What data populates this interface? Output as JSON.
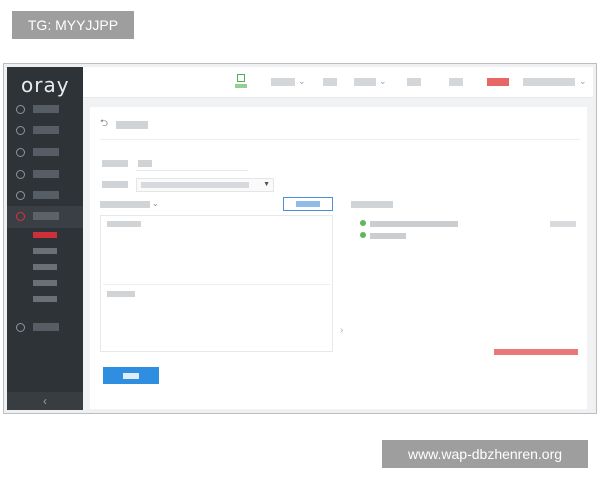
{
  "overlay_top_left": "TG: MYYJJPP",
  "overlay_bottom_right": "www.wap-dbzhenren.org",
  "app": {
    "logo": "oray",
    "collapse_glyph": "‹"
  },
  "sidebar": {
    "items": [
      {
        "icon": "grid-icon",
        "label": ""
      },
      {
        "icon": "user-icon",
        "label": ""
      },
      {
        "icon": "headset-icon",
        "label": ""
      },
      {
        "icon": "cube-icon",
        "label": ""
      },
      {
        "icon": "gear-icon",
        "label": ""
      },
      {
        "icon": "cloud-icon",
        "label": ""
      },
      {
        "icon": "router-icon",
        "label": ""
      }
    ],
    "sub_items": [
      {
        "label": ""
      },
      {
        "label": ""
      },
      {
        "label": ""
      },
      {
        "label": ""
      },
      {
        "label": ""
      }
    ]
  },
  "topbar": {
    "items": [
      {
        "label": ""
      },
      {
        "label": ""
      },
      {
        "label": ""
      },
      {
        "label": ""
      },
      {
        "label": ""
      },
      {
        "label": ""
      },
      {
        "label": ""
      }
    ]
  },
  "page": {
    "back_glyph": "⮌",
    "title": "",
    "network_name_label": "",
    "network_name_value": "",
    "network_type_label": "",
    "network_type_value": "",
    "groups_label": "",
    "add_button_label": "",
    "left_panel_top_label": "",
    "left_panel_bottom_label": "",
    "right_heading": "",
    "networks": [
      {
        "name": "",
        "ip": "",
        "status": "online"
      },
      {
        "name": "",
        "ip": "",
        "status": "online"
      }
    ],
    "help_link": "",
    "done_button_label": ""
  },
  "colors": {
    "sidebar_bg": "#2e3338",
    "accent_red": "#e0303a",
    "primary_blue": "#2f8ee0",
    "online_green": "#5cb85c"
  }
}
